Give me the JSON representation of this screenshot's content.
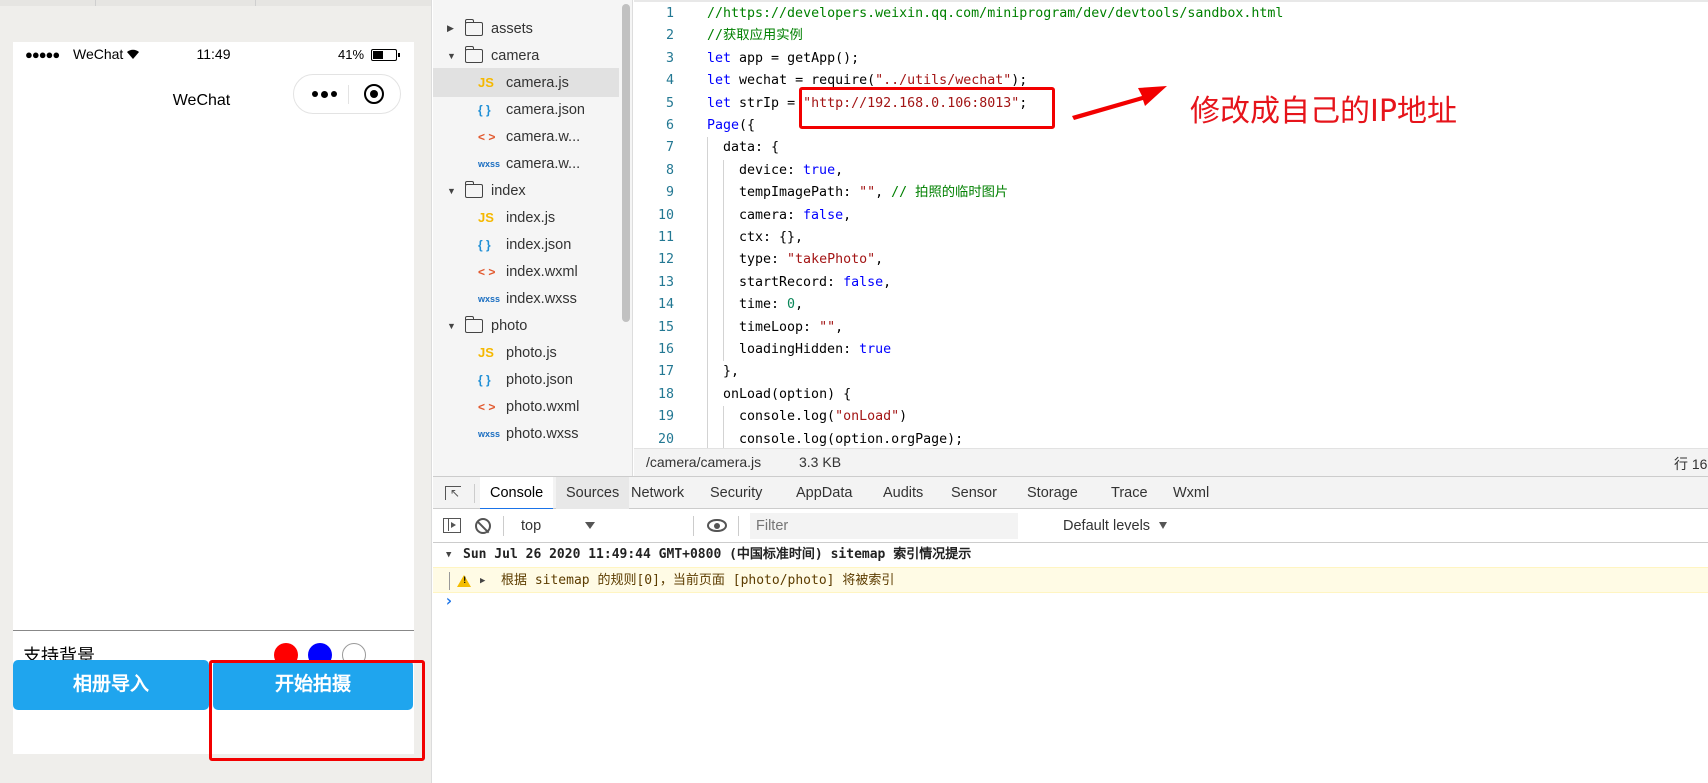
{
  "simulator": {
    "status": {
      "signal": "●●●●●",
      "carrier": "WeChat",
      "time": "11:49",
      "battery": "41%"
    },
    "nav_title": "WeChat",
    "bg_label": "支持背景",
    "colors": [
      "#ff0000",
      "#0000ff",
      "#ffffff"
    ],
    "btn_album": "相册导入",
    "btn_shoot": "开始拍摄"
  },
  "tree": [
    {
      "type": "folder",
      "label": "assets",
      "open": false
    },
    {
      "type": "folder",
      "label": "camera",
      "open": true
    },
    {
      "type": "file",
      "icon": "JS",
      "kind": "js",
      "label": "camera.js",
      "selected": true
    },
    {
      "type": "file",
      "icon": "{ }",
      "kind": "json",
      "label": "camera.json"
    },
    {
      "type": "file",
      "icon": "< >",
      "kind": "wxml",
      "label": "camera.w..."
    },
    {
      "type": "file",
      "icon": "wxss",
      "kind": "wxss",
      "label": "camera.w..."
    },
    {
      "type": "folder",
      "label": "index",
      "open": true
    },
    {
      "type": "file",
      "icon": "JS",
      "kind": "js",
      "label": "index.js"
    },
    {
      "type": "file",
      "icon": "{ }",
      "kind": "json",
      "label": "index.json"
    },
    {
      "type": "file",
      "icon": "< >",
      "kind": "wxml",
      "label": "index.wxml"
    },
    {
      "type": "file",
      "icon": "wxss",
      "kind": "wxss",
      "label": "index.wxss"
    },
    {
      "type": "folder",
      "label": "photo",
      "open": true
    },
    {
      "type": "file",
      "icon": "JS",
      "kind": "js",
      "label": "photo.js"
    },
    {
      "type": "file",
      "icon": "{ }",
      "kind": "json",
      "label": "photo.json"
    },
    {
      "type": "file",
      "icon": "< >",
      "kind": "wxml",
      "label": "photo.wxml"
    },
    {
      "type": "file",
      "icon": "wxss",
      "kind": "wxss",
      "label": "photo.wxss"
    }
  ],
  "code": [
    {
      "n": "1",
      "indent": 0,
      "tokens": [
        [
          "c-com",
          "//https://developers.weixin.qq.com/miniprogram/dev/devtools/sandbox.html"
        ]
      ]
    },
    {
      "n": "2",
      "indent": 0,
      "tokens": [
        [
          "c-com",
          "//获取应用实例"
        ]
      ]
    },
    {
      "n": "3",
      "indent": 0,
      "tokens": [
        [
          "c-kw",
          "let"
        ],
        [
          "",
          " app = getApp();"
        ]
      ]
    },
    {
      "n": "4",
      "indent": 0,
      "tokens": [
        [
          "c-kw",
          "let"
        ],
        [
          "",
          " wechat = require("
        ],
        [
          "c-str",
          "\"../utils/wechat\""
        ],
        [
          "",
          ");"
        ]
      ]
    },
    {
      "n": "5",
      "indent": 0,
      "tokens": [
        [
          "c-kw",
          "let"
        ],
        [
          "",
          " strIp = "
        ],
        [
          "c-str",
          "\"http://192.168.0.106:8013\""
        ],
        [
          "",
          ";"
        ]
      ]
    },
    {
      "n": "6",
      "indent": 0,
      "tokens": [
        [
          "c-kw",
          "Page"
        ],
        [
          "",
          "({"
        ]
      ]
    },
    {
      "n": "7",
      "indent": 1,
      "tokens": [
        [
          "",
          "data: {"
        ]
      ]
    },
    {
      "n": "8",
      "indent": 2,
      "tokens": [
        [
          "",
          "device: "
        ],
        [
          "c-kw",
          "true"
        ],
        [
          "",
          ","
        ]
      ]
    },
    {
      "n": "9",
      "indent": 2,
      "tokens": [
        [
          "",
          "tempImagePath: "
        ],
        [
          "c-str",
          "\"\""
        ],
        [
          "",
          ", "
        ],
        [
          "c-com",
          "// 拍照的临时图片"
        ]
      ]
    },
    {
      "n": "10",
      "indent": 2,
      "tokens": [
        [
          "",
          "camera: "
        ],
        [
          "c-kw",
          "false"
        ],
        [
          "",
          ","
        ]
      ]
    },
    {
      "n": "11",
      "indent": 2,
      "tokens": [
        [
          "",
          "ctx: {},"
        ]
      ]
    },
    {
      "n": "12",
      "indent": 2,
      "tokens": [
        [
          "",
          "type: "
        ],
        [
          "c-str",
          "\"takePhoto\""
        ],
        [
          "",
          ","
        ]
      ]
    },
    {
      "n": "13",
      "indent": 2,
      "tokens": [
        [
          "",
          "startRecord: "
        ],
        [
          "c-kw",
          "false"
        ],
        [
          "",
          ","
        ]
      ]
    },
    {
      "n": "14",
      "indent": 2,
      "tokens": [
        [
          "",
          "time: "
        ],
        [
          "c-num",
          "0"
        ],
        [
          "",
          ","
        ]
      ]
    },
    {
      "n": "15",
      "indent": 2,
      "tokens": [
        [
          "",
          "timeLoop: "
        ],
        [
          "c-str",
          "\"\""
        ],
        [
          "",
          ","
        ]
      ]
    },
    {
      "n": "16",
      "indent": 2,
      "tokens": [
        [
          "",
          "loadingHidden: "
        ],
        [
          "c-kw",
          "true"
        ]
      ]
    },
    {
      "n": "17",
      "indent": 1,
      "tokens": [
        [
          "",
          "},"
        ]
      ]
    },
    {
      "n": "18",
      "indent": 1,
      "tokens": [
        [
          "",
          "onLoad(option) {"
        ]
      ]
    },
    {
      "n": "19",
      "indent": 2,
      "tokens": [
        [
          "",
          "console.log("
        ],
        [
          "c-str",
          "\"onLoad\""
        ],
        [
          "",
          ")"
        ]
      ]
    },
    {
      "n": "20",
      "indent": 2,
      "tokens": [
        [
          "",
          "console.log(option.orgPage);"
        ]
      ]
    }
  ],
  "annotation": "修改成自己的IP地址",
  "status_strip": {
    "path": "/camera/camera.js",
    "size": "3.3 KB",
    "cursor": "行 16"
  },
  "devtools": {
    "tabs": [
      "Console",
      "Sources",
      "Network",
      "Security",
      "AppData",
      "Audits",
      "Sensor",
      "Storage",
      "Trace",
      "Wxml"
    ],
    "active_tab": "Console",
    "context": "top",
    "filter_placeholder": "Filter",
    "levels": "Default levels",
    "group_message": "Sun Jul 26 2020 11:49:44 GMT+0800 (中国标准时间) sitemap 索引情况提示",
    "warning_message": "根据 sitemap 的规则[0]，当前页面 [photo/photo] 将被索引",
    "prompt": "›"
  }
}
